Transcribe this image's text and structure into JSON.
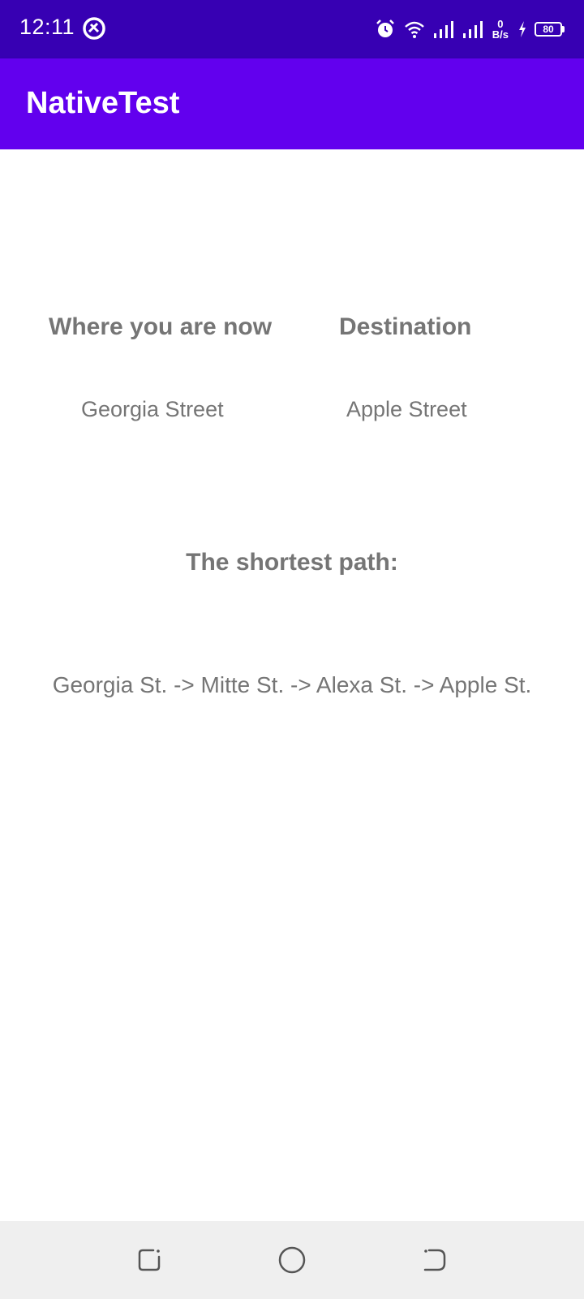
{
  "status_bar": {
    "time": "12:11",
    "net_speed_value": "0",
    "net_speed_unit": "B/s",
    "battery_level": "80",
    "icons": [
      "vpn-icon",
      "alarm-icon",
      "wifi-icon",
      "signal-icon",
      "signal-icon",
      "charging-icon",
      "battery-icon"
    ]
  },
  "app_bar": {
    "title": "NativeTest",
    "color": "#6200ee",
    "status_color": "#3700b3"
  },
  "main": {
    "origin_label": "Where you are now",
    "destination_label": "Destination",
    "origin_value": "Georgia Street",
    "destination_value": "Apple Street",
    "path_label": "The shortest path:",
    "path_value": "Georgia St. -> Mitte St. -> Alexa St. -> Apple St.",
    "text_color": "#757575"
  },
  "nav_bar": {
    "icons": [
      "recents-icon",
      "home-icon",
      "back-icon"
    ]
  }
}
